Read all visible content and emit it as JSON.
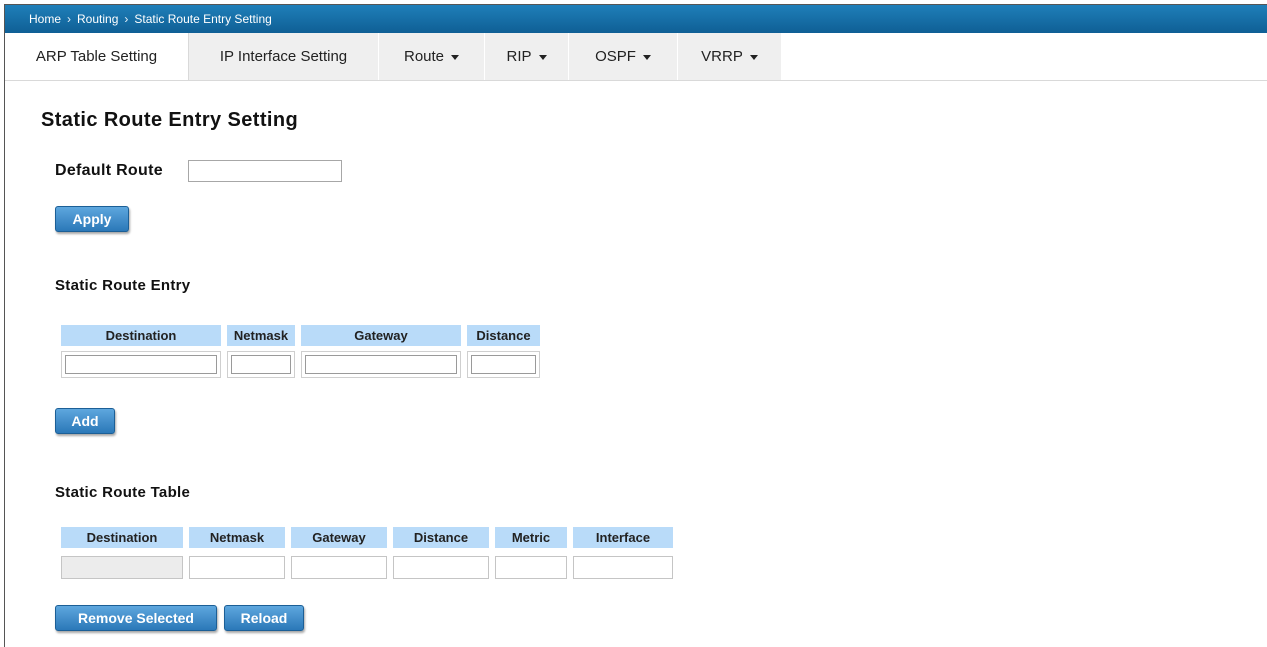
{
  "breadcrumb": {
    "items": [
      "Home",
      "Routing",
      "Static Route Entry Setting"
    ],
    "separator": "›"
  },
  "tabs": [
    {
      "label": "ARP Table Setting",
      "dropdown": false
    },
    {
      "label": "IP Interface Setting",
      "dropdown": false
    },
    {
      "label": "Route",
      "dropdown": true
    },
    {
      "label": "RIP",
      "dropdown": true
    },
    {
      "label": "OSPF",
      "dropdown": true
    },
    {
      "label": "VRRP",
      "dropdown": true
    }
  ],
  "page": {
    "title": "Static Route Entry Setting"
  },
  "default_route": {
    "label": "Default Route",
    "value": ""
  },
  "apply_button": {
    "label": "Apply"
  },
  "entry": {
    "heading": "Static Route Entry",
    "columns": [
      "Destination",
      "Netmask",
      "Gateway",
      "Distance"
    ],
    "values": [
      "",
      "",
      "",
      ""
    ],
    "add_label": "Add"
  },
  "table": {
    "heading": "Static Route Table",
    "columns": [
      "Destination",
      "Netmask",
      "Gateway",
      "Distance",
      "Metric",
      "Interface"
    ],
    "rows": [
      [
        "",
        "",
        "",
        "",
        "",
        ""
      ]
    ],
    "remove_label": "Remove Selected",
    "reload_label": "Reload"
  },
  "colors": {
    "header_bar": "#1a72ab",
    "column_header": "#b9dbf9",
    "button": "#2b78b8"
  }
}
